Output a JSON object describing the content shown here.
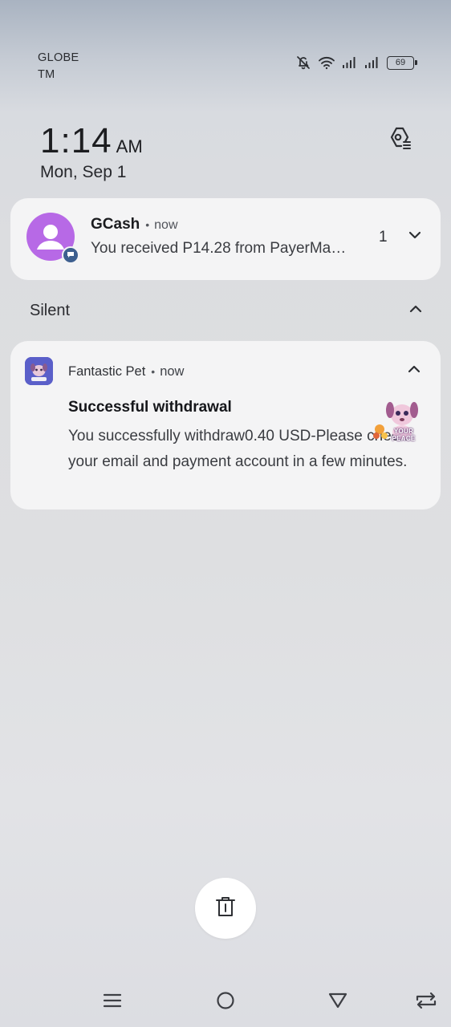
{
  "status_bar": {
    "carrier_line1": "GLOBE",
    "carrier_line2": "TM",
    "icons": [
      "bell-off-icon",
      "wifi-icon",
      "signal-icon",
      "signal-icon",
      "battery-icon"
    ],
    "battery_level": "69"
  },
  "lockscreen": {
    "time": "1:14",
    "ampm": "AM",
    "date": "Mon, Sep 1",
    "settings_icon": "settings-icon"
  },
  "notifications": {
    "gcash": {
      "title": "GCash",
      "separator": "•",
      "time": "now",
      "message": "You received P14.28 from PayerMa…",
      "count": "1",
      "avatar_color": "#b769e6",
      "badge_color": "#3d5f8f"
    },
    "silent": {
      "label": "Silent"
    },
    "fantastic_pet": {
      "app_name": "Fantastic Pet",
      "separator": "•",
      "time": "now",
      "title": "Successful withdrawal",
      "body": "You successfully withdraw0.40 USD-Please check your email and payment account in a few minutes.",
      "thumbnail_text": "YOUR PEACE",
      "icon_color": "#5a5fc9"
    }
  },
  "actions": {
    "clear_all_icon": "trash-icon"
  },
  "nav_bar": {
    "icons": [
      "menu-icon",
      "home-icon",
      "back-icon",
      "rotate-icon"
    ]
  }
}
